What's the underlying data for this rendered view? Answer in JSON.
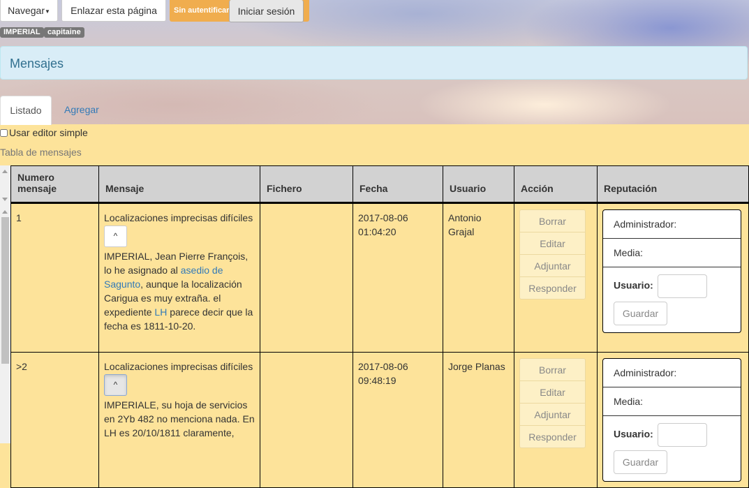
{
  "topbar": {
    "nav_label": "Navegar",
    "link_label": "Enlazar esta página",
    "auth_status": "Sin autentificar",
    "login_label": "Iniciar sesión"
  },
  "badges": [
    "IMPERIAL",
    "capitaine"
  ],
  "panel": {
    "title": "Mensajes"
  },
  "tabs": [
    {
      "label": "Listado",
      "active": true
    },
    {
      "label": "Agregar",
      "active": false
    }
  ],
  "simple_editor_label": "Usar editor simple",
  "table_caption": "Tabla de mensajes",
  "columns": [
    "Numero mensaje",
    "Mensaje",
    "Fichero",
    "Fecha",
    "Usuario",
    "Acción",
    "Reputación"
  ],
  "actions": [
    "Borrar",
    "Editar",
    "Adjuntar",
    "Responder"
  ],
  "expand_symbol": "^",
  "reputation": {
    "admin_label": "Administrador:",
    "media_label": "Media:",
    "user_label": "Usuario:",
    "save_label": "Guardar"
  },
  "rows": [
    {
      "numero": "1",
      "titulo": "Localizaciones imprecisas difíciles",
      "body_1": "IMPERIAL, Jean Pierre François, lo he asignado al ",
      "link_1": "asedio de Sagunto",
      "body_2": ", aunque la localización Carigua es muy extraña. el expediente ",
      "link_2": "LH",
      "body_3": " parece decir que la fecha es 1811-10-20.",
      "fichero": "",
      "fecha": "2017-08-06 01:04:20",
      "usuario": "Antonio Grajal"
    },
    {
      "numero": ">2",
      "titulo": "Localizaciones imprecisas difíciles",
      "body_1": "IMPERIALE, su hoja de servicios en 2Yb 482 no menciona nada. En LH es 20/10/1811 claramente,",
      "fichero": "",
      "fecha": "2017-08-06 09:48:19",
      "usuario": "Jorge Planas"
    }
  ]
}
